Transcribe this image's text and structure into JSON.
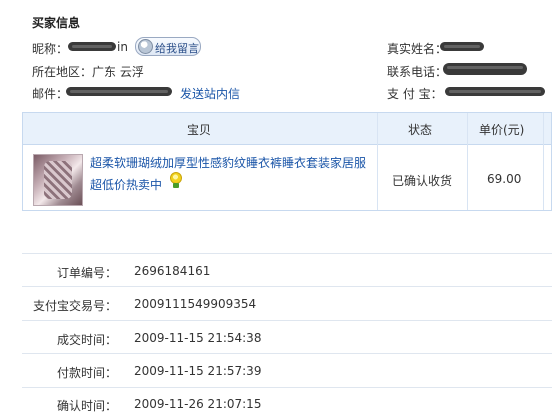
{
  "buyer_info": {
    "title": "买家信息",
    "nickname_label": "昵称：",
    "nickname_suffix": "in",
    "message_button": "给我留言",
    "region_label": "所在地区：",
    "region_value": "广东 云浮",
    "mail_label": "邮件：",
    "site_message_link": "发送站内信",
    "realname_label": "真实姓名：",
    "phone_label": "联系电话：",
    "alipay_label": "支 付 宝："
  },
  "order_table": {
    "headers": {
      "item": "宝贝",
      "status": "状态",
      "price": "单价(元)"
    },
    "item_title_line1": "超柔软珊瑚绒加厚型性感豹纹睡衣裤睡衣套装家居服",
    "item_title_line2": "超低价热卖中",
    "status": "已确认收货",
    "price": "69.00"
  },
  "order_details": [
    {
      "label": "订单编号：",
      "value": "2696184161"
    },
    {
      "label": "支付宝交易号：",
      "value": "2009111549909354"
    },
    {
      "label": "成交时间：",
      "value": "2009-11-15 21:54:38"
    },
    {
      "label": "付款时间：",
      "value": "2009-11-15 21:57:39"
    },
    {
      "label": "确认时间：",
      "value": "2009-11-26 21:07:15"
    }
  ],
  "icons": [
    "message-bubble-icon",
    "bulb-icon"
  ]
}
